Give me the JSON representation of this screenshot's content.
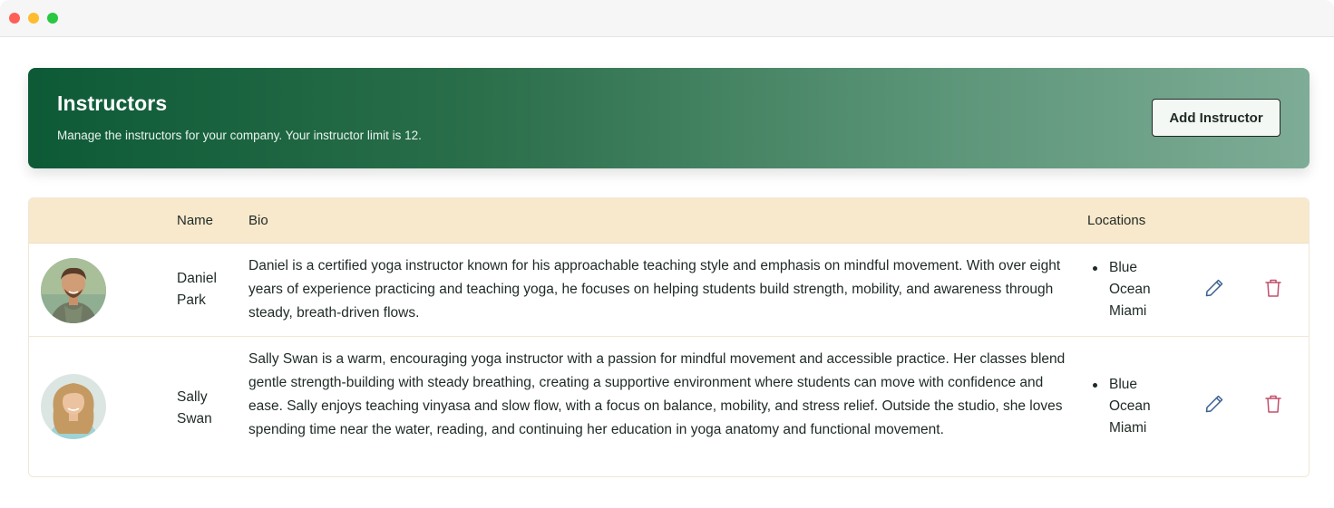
{
  "header": {
    "title": "Instructors",
    "subtitle": "Manage the instructors for your company. Your instructor limit is 12.",
    "add_button_label": "Add Instructor"
  },
  "table": {
    "columns": [
      "",
      "Name",
      "Bio",
      "Locations",
      ""
    ],
    "rows": [
      {
        "name_first": "Daniel",
        "name_last": "Park",
        "bio": "Daniel is a certified yoga instructor known for his approachable teaching style and emphasis on mindful movement. With over eight years of experience practicing and teaching yoga, he focuses on helping students build strength, mobility, and awareness through steady, breath-driven flows.",
        "location": "Blue Ocean Miami"
      },
      {
        "name_first": "Sally",
        "name_last": "Swan",
        "bio": "Sally Swan is a warm, encouraging yoga instructor with a passion for mindful movement and accessible practice. Her classes blend gentle strength-building with steady breathing, creating a supportive environment where students can move with confidence and ease. Sally enjoys teaching vinyasa and slow flow, with a focus on balance, mobility, and stress relief. Outside the studio, she loves spending time near the water, reading, and continuing her education in yoga anatomy and functional movement.",
        "location": "Blue Ocean Miami"
      }
    ]
  },
  "icons": {
    "edit": "pencil-icon",
    "delete": "trash-icon"
  },
  "colors": {
    "banner_start": "#0d5a37",
    "banner_end": "#7eac96",
    "table_header_bg": "#f8e8cc",
    "edit_icon": "#3b5f8f",
    "delete_icon": "#c2506a"
  }
}
